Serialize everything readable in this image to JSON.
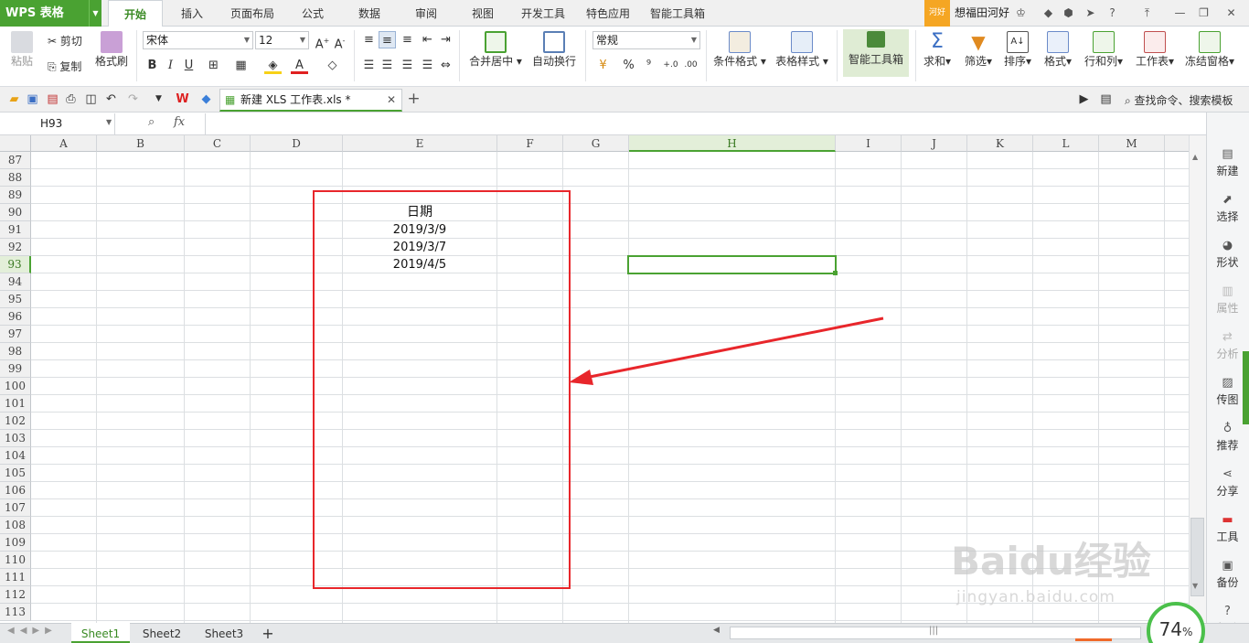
{
  "app": {
    "logo": "WPS 表格"
  },
  "menu": {
    "tabs": [
      "开始",
      "插入",
      "页面布局",
      "公式",
      "数据",
      "审阅",
      "视图",
      "开发工具",
      "特色应用",
      "智能工具箱"
    ],
    "active_tab": "开始"
  },
  "user": {
    "badge": "河好",
    "name": "想福田河好"
  },
  "ribbon": {
    "paste": "粘贴",
    "cut": "剪切",
    "copy": "复制",
    "format_painter": "格式刷",
    "font_name": "宋体",
    "font_size": "12",
    "bold": "B",
    "italic": "I",
    "underline": "U",
    "merge_center": "合并居中",
    "wrap_text": "自动换行",
    "number_format": "常规",
    "percent": "%",
    "thousands": "⁹",
    "cond_format": "条件格式",
    "table_style": "表格样式",
    "smart_toolbox": "智能工具箱",
    "sum": "求和",
    "filter": "筛选",
    "sort": "排序",
    "format": "格式",
    "row_col": "行和列",
    "worksheet": "工作表",
    "freeze": "冻结窗格"
  },
  "doc": {
    "tab_title": "新建 XLS 工作表.xls *",
    "search": "查找命令、搜索模板"
  },
  "formula": {
    "cell_ref": "H93",
    "fx": "fx",
    "value": ""
  },
  "grid": {
    "columns": [
      "A",
      "B",
      "C",
      "D",
      "E",
      "F",
      "G",
      "H",
      "I",
      "J",
      "K",
      "L",
      "M"
    ],
    "selected_column": "H",
    "rows": [
      "87",
      "88",
      "89",
      "90",
      "91",
      "92",
      "93",
      "94",
      "95",
      "96",
      "97",
      "98",
      "99",
      "100",
      "101",
      "102",
      "103",
      "104",
      "105",
      "106",
      "107",
      "108",
      "109",
      "110",
      "111",
      "112",
      "113"
    ],
    "selected_row": "93",
    "cells": {
      "E90": "日期",
      "E91": "2019/3/9",
      "E92": "2019/3/7",
      "E93": "2019/4/5"
    }
  },
  "right_panel": [
    {
      "label": "新建",
      "icon": "new-file-icon",
      "enabled": true
    },
    {
      "label": "选择",
      "icon": "select-icon",
      "enabled": true
    },
    {
      "label": "形状",
      "icon": "shape-icon",
      "enabled": true
    },
    {
      "label": "属性",
      "icon": "property-icon",
      "enabled": false
    },
    {
      "label": "分析",
      "icon": "analysis-icon",
      "enabled": false
    },
    {
      "label": "传图",
      "icon": "image-upload-icon",
      "enabled": true
    },
    {
      "label": "推荐",
      "icon": "recommend-icon",
      "enabled": true
    },
    {
      "label": "分享",
      "icon": "share-icon",
      "enabled": true
    },
    {
      "label": "工具",
      "icon": "toolbox-icon",
      "enabled": true
    },
    {
      "label": "备份",
      "icon": "backup-icon",
      "enabled": true
    },
    {
      "label": "帮助",
      "icon": "help-icon",
      "enabled": true
    }
  ],
  "sheets": {
    "tabs": [
      "Sheet1",
      "Sheet2",
      "Sheet3"
    ],
    "active": "Sheet1",
    "add": "+"
  },
  "zoom": {
    "value": "74",
    "unit": "%"
  },
  "watermark": {
    "main": "Baidu经验",
    "sub": "jingyan.baidu.com"
  },
  "colors": {
    "accent": "#4aa232",
    "annotation": "#e8262b"
  }
}
